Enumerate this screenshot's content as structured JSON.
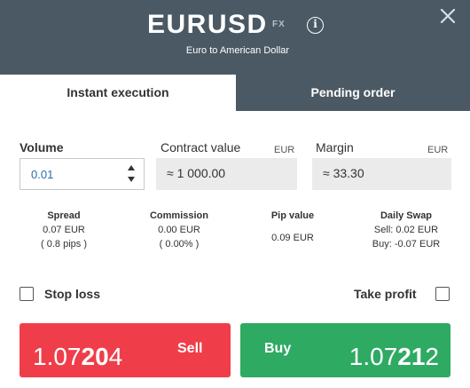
{
  "header": {
    "symbol": "EURUSD",
    "symbol_type": "FX",
    "info_icon": "info-icon",
    "subtitle": "Euro to American Dollar",
    "close_icon": "close-icon"
  },
  "tabs": [
    {
      "label": "Instant execution",
      "active": true
    },
    {
      "label": "Pending order",
      "active": false
    }
  ],
  "volume": {
    "label": "Volume",
    "value": "0.01"
  },
  "contract_value": {
    "label": "Contract value",
    "currency": "EUR",
    "value": "≈ 1 000.00"
  },
  "margin": {
    "label": "Margin",
    "currency": "EUR",
    "value": "≈ 33.30"
  },
  "stats": {
    "spread": {
      "title": "Spread",
      "line1": "0.07 EUR",
      "line2": "( 0.8 pips )"
    },
    "commission": {
      "title": "Commission",
      "line1": "0.00 EUR",
      "line2": "( 0.00% )"
    },
    "pip_value": {
      "title": "Pip value",
      "line1": "0.09 EUR"
    },
    "daily_swap": {
      "title": "Daily Swap",
      "line1": "Sell: 0.02 EUR",
      "line2": "Buy: -0.07 EUR"
    }
  },
  "stop_loss": {
    "label": "Stop loss",
    "checked": false
  },
  "take_profit": {
    "label": "Take profit",
    "checked": false
  },
  "sell": {
    "label": "Sell",
    "price_prefix": "1.07",
    "price_big": "20",
    "price_suffix": "4",
    "color": "#ef3e4a"
  },
  "buy": {
    "label": "Buy",
    "price_prefix": "1.07",
    "price_big": "21",
    "price_suffix": "2",
    "color": "#2eaa63"
  },
  "colors": {
    "header_bg": "#4a5964",
    "input_text": "#2b6cb0"
  }
}
